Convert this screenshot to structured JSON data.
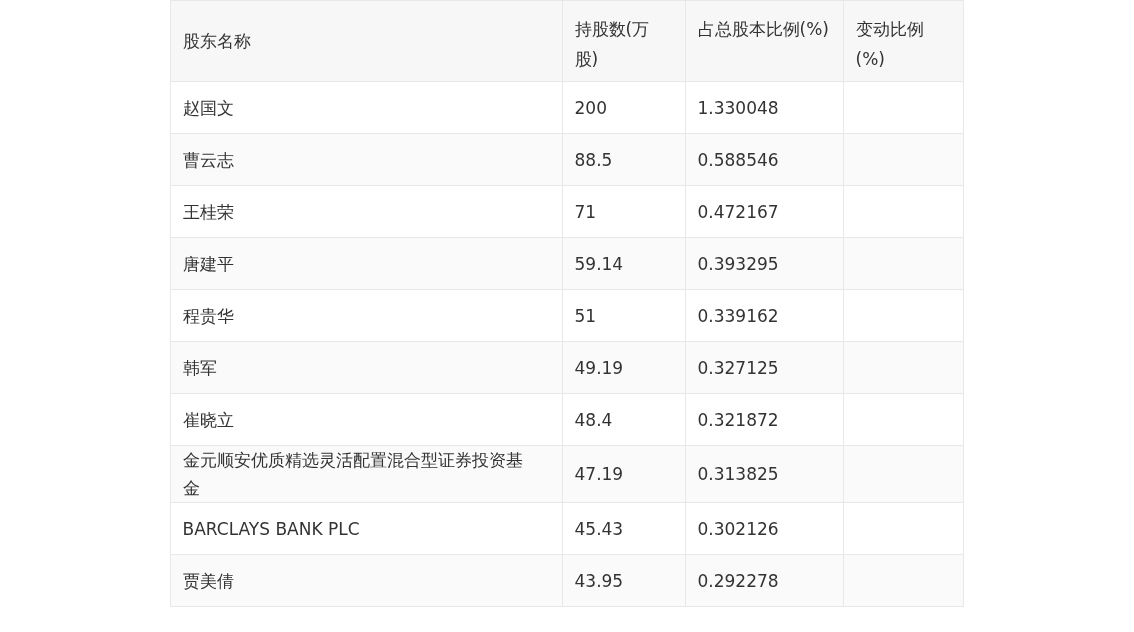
{
  "table": {
    "columns": [
      "股东名称",
      "持股数(万股)",
      "占总股本比例(%)",
      "变动比例(%)"
    ],
    "rows": [
      [
        "赵国文",
        "200",
        "1.330048",
        ""
      ],
      [
        "曹云志",
        "88.5",
        "0.588546",
        ""
      ],
      [
        "王桂荣",
        "71",
        "0.472167",
        ""
      ],
      [
        "唐建平",
        "59.14",
        "0.393295",
        ""
      ],
      [
        "程贵华",
        "51",
        "0.339162",
        ""
      ],
      [
        "韩军",
        "49.19",
        "0.327125",
        ""
      ],
      [
        "崔晓立",
        "48.4",
        "0.321872",
        ""
      ],
      [
        "金元顺安优质精选灵活配置混合型证券投资基金",
        "47.19",
        "0.313825",
        ""
      ],
      [
        "BARCLAYS BANK PLC",
        "45.43",
        "0.302126",
        ""
      ],
      [
        "贾美倩",
        "43.95",
        "0.292278",
        ""
      ]
    ]
  }
}
